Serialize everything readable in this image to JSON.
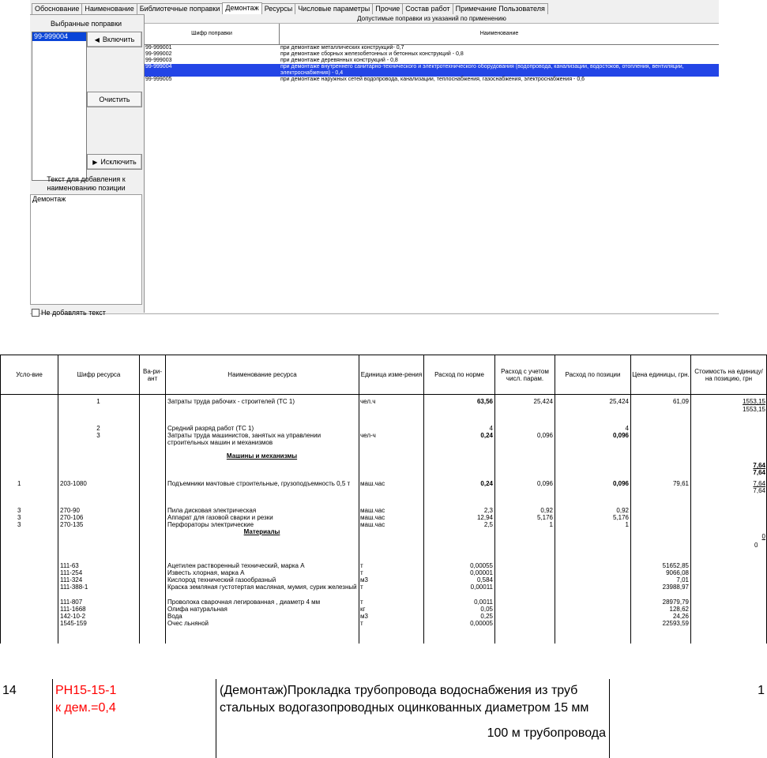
{
  "tabs": [
    "Обоснование",
    "Наименование",
    "Библиотечные поправки",
    "Демонтаж",
    "Ресурсы",
    "Числовые параметры",
    "Прочие",
    "Состав работ",
    "Примечание Пользователя"
  ],
  "active_tab": "Демонтаж",
  "left": {
    "selected_caption": "Выбранные поправки",
    "selected_items": [
      "99-999004"
    ],
    "include_button": "Включить",
    "clear_button": "Очистить",
    "exclude_button": "Исключить",
    "text_caption": "Текст для добавления к наименованию позиции",
    "text_value": "Демонтаж",
    "no_add_text_label": "Не добавлять текст"
  },
  "right": {
    "caption": "Допустимые поправки из указаний по применению",
    "col_code": "Шифр поправки",
    "col_name": "Наименование",
    "rows": [
      {
        "code": "99-999001",
        "name": "при демонтаже металлических конструкций- 0,7"
      },
      {
        "code": "99-999002",
        "name": "при демонтаже сборных железобетонных и бетонных конструкций - 0,8"
      },
      {
        "code": "99-999003",
        "name": "при демонтаже деревянных конструкций - 0,8"
      },
      {
        "code": "99-999004",
        "name": "при демонтаже внутреннего санитарно-технического и электротехнического оборудования (водопровода, канализации, водостоков, отопления, вентиляции, электроснабжения) - 0,4",
        "selected": true
      },
      {
        "code": "99-999005",
        "name": "при демонтаже наружных сетей водопровода, канализации, теплоснабжения, газоснабжения, электроснабжения - 0,6"
      }
    ]
  },
  "table": {
    "headers": {
      "cond": "Усло-вие",
      "code": "Шифр ресурса",
      "var": "Ва-ри-ант",
      "name": "Наименование ресурса",
      "unit": "Единица изме-рения",
      "norm": "Расход по норме",
      "param": "Расход с учетом числ. парам.",
      "pos": "Расход по позиции",
      "price": "Цена единицы, грн.",
      "cost": "Стоимость на единицу/ на позицию, грн"
    },
    "rows": [
      {
        "cond": "",
        "code": "1",
        "name": "Затраты труда рабочих - строителей (ТС 1)",
        "unit": "чел.ч",
        "norm": "63,56",
        "param": "25,424",
        "pos": "25,424",
        "price": "61,09",
        "cost1": "1553,15",
        "cost2": "1553,15"
      },
      {
        "cond": "",
        "code": "2",
        "name": "Средний разряд работ (ТС 1)",
        "unit": "",
        "norm": "4",
        "param": "",
        "pos": "4",
        "price": "",
        "cost1": "",
        "cost2": ""
      },
      {
        "cond": "",
        "code": "3",
        "name": "Затраты труда машинистов, занятых на управлении строительных машин и механизмов",
        "unit": "чел-ч",
        "norm": "0,24",
        "param": "0,096",
        "pos": "0,096",
        "price": "",
        "cost1": "",
        "cost2": ""
      },
      {
        "section": "Машины и механизмы",
        "cost1": "7,64",
        "cost2": "7,64"
      },
      {
        "cond": "1",
        "code": "203-1080",
        "name": "Подъемники мачтовые строительные, грузоподъемность 0,5 т",
        "unit": "маш.час",
        "norm": "0,24",
        "param": "0,096",
        "pos": "0,096",
        "price": "79,61",
        "cost1": "7,64",
        "cost2": "7,64"
      },
      {
        "cond": "3",
        "code": "270-90",
        "name": "Пила дисковая электрическая",
        "unit": "маш.час",
        "norm": "2,3",
        "param": "0,92",
        "pos": "0,92"
      },
      {
        "cond": "3",
        "code": "270-106",
        "name": "Аппарат для газовой сварки и резки",
        "unit": "маш.час",
        "norm": "12,94",
        "param": "5,176",
        "pos": "5,176"
      },
      {
        "cond": "3",
        "code": "270-135",
        "name": "Перфораторы электрические",
        "unit": "маш.час",
        "norm": "2,5",
        "param": "1",
        "pos": "1"
      },
      {
        "section": "Материалы",
        "cost1": "0",
        "cost2": "0"
      },
      {
        "code": "111-63",
        "name": "Ацетилен растворенный технический, марка А",
        "unit": "т",
        "norm": "0,00055",
        "price": "51652,85"
      },
      {
        "code": "111-254",
        "name": "Известь хлорная, марка А",
        "unit": "т",
        "norm": "0,00001",
        "price": "9066,08"
      },
      {
        "code": "111-324",
        "name": "Кислород технический газообразный",
        "unit": "м3",
        "norm": "0,584",
        "price": "7,01"
      },
      {
        "code": "111-388-1",
        "name": "Краска земляная густотертая масляная, мумия, сурик железный",
        "unit": "т",
        "norm": "0,00011",
        "price": "23988,97"
      },
      {
        "code": "111-807",
        "name": "Проволока сварочная легированная , диаметр 4 мм",
        "unit": "т",
        "norm": "0,0011",
        "price": "28979,79"
      },
      {
        "code": "111-1668",
        "name": "Олифа натуральная",
        "unit": "кг",
        "norm": "0,05",
        "price": "128,62"
      },
      {
        "code": "142-10-2",
        "name": "Вода",
        "unit": "м3",
        "norm": "0,25",
        "price": "24,26"
      },
      {
        "code": "1545-159",
        "name": "Очес льняной",
        "unit": "т",
        "norm": "0,00005",
        "price": "22593,59"
      }
    ]
  },
  "bottom": {
    "num": "14",
    "code": "РН15-15-1",
    "coef": "к дем.=0,4",
    "name": "(Демонтаж)Прокладка трубопровода водоснабжения из труб стальных водогазопроводных оцинкованных диаметром 15 мм",
    "unit": "100 м трубопровода",
    "qty": "1",
    "code_color": "#ff0000"
  }
}
